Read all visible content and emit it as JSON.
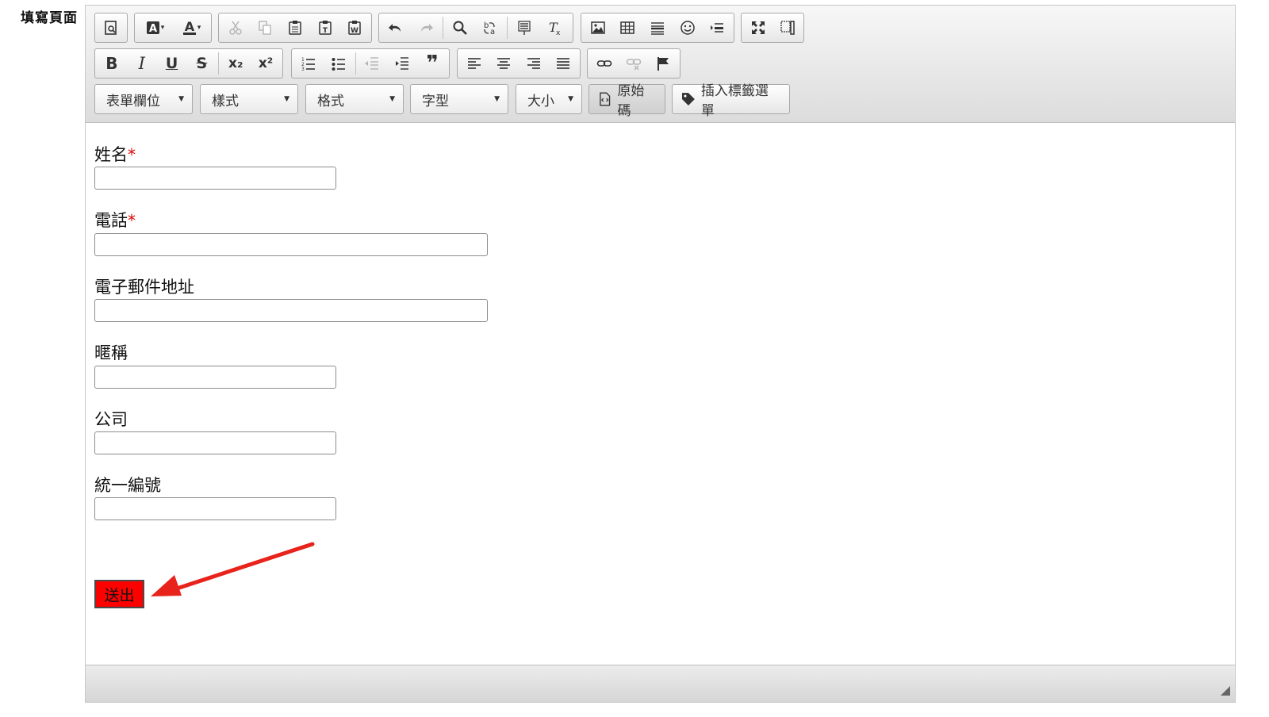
{
  "page": {
    "label": "填寫頁面"
  },
  "toolbar": {
    "format_text": {
      "bold": "B",
      "italic": "I",
      "underline": "U",
      "strike": "S",
      "subscript": "x₂",
      "superscript": "x²",
      "blockquote": "❞"
    },
    "combos": [
      {
        "label": "表單欄位"
      },
      {
        "label": "樣式"
      },
      {
        "label": "格式"
      },
      {
        "label": "字型"
      },
      {
        "label": "大小"
      }
    ],
    "source_label": "原始碼",
    "insert_tag_label": "插入標籤選單"
  },
  "form": {
    "fields": [
      {
        "label": "姓名",
        "required": true,
        "required_mark": "*"
      },
      {
        "label": "電話",
        "required": true,
        "required_mark": "*"
      },
      {
        "label": "電子郵件地址",
        "required": false
      },
      {
        "label": "暱稱",
        "required": false
      },
      {
        "label": "公司",
        "required": false
      },
      {
        "label": "統一編號",
        "required": false
      }
    ],
    "submit_label": "送出"
  },
  "colors": {
    "submit_bg": "#ff0000",
    "required": "#e00000",
    "arrow": "#e8231c"
  }
}
